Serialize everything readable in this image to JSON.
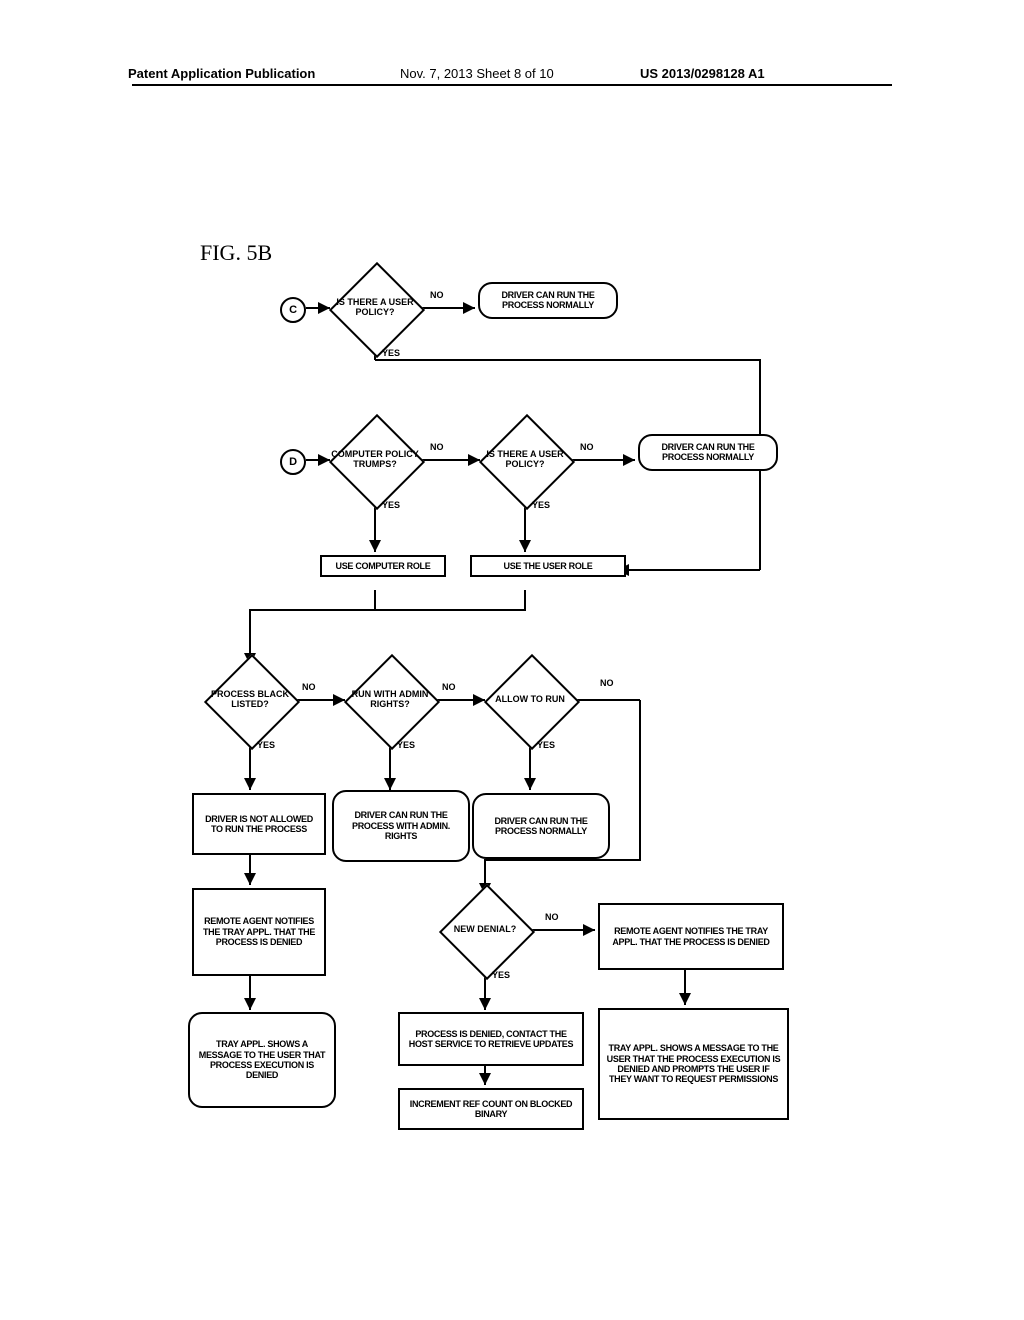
{
  "header": {
    "left": "Patent Application Publication",
    "mid": "Nov. 7, 2013  Sheet 8 of 10",
    "right": "US 2013/0298128 A1"
  },
  "fig_title": "FIG. 5B",
  "connectors": {
    "c": "C",
    "d": "D"
  },
  "decisions": {
    "d1": "IS THERE A USER POLICY?",
    "d2": "COMPUTER POLICY TRUMPS?",
    "d3": "IS THERE A USER POLICY?",
    "d4": "PROCESS BLACK LISTED?",
    "d5": "RUN WITH ADMIN RIGHTS?",
    "d6": "ALLOW TO RUN",
    "d7": "NEW DENIAL?"
  },
  "terminals": {
    "t1": "DRIVER CAN RUN THE PROCESS NORMALLY",
    "t2": "DRIVER CAN RUN THE PROCESS NORMALLY",
    "t3": "DRIVER CAN RUN THE PROCESS WITH ADMIN. RIGHTS",
    "t4": "DRIVER CAN RUN THE PROCESS NORMALLY",
    "t5": "TRAY APPL. SHOWS A MESSAGE TO THE USER THAT PROCESS EXECUTION IS DENIED"
  },
  "processes": {
    "p1": "USE COMPUTER ROLE",
    "p2": "USE THE USER ROLE",
    "p3": "DRIVER IS NOT ALLOWED TO RUN THE PROCESS",
    "p4": "REMOTE AGENT NOTIFIES THE TRAY APPL. THAT THE PROCESS IS DENIED",
    "p5": "REMOTE AGENT NOTIFIES THE TRAY APPL. THAT THE PROCESS IS DENIED",
    "p6": "PROCESS IS DENIED, CONTACT THE HOST SERVICE TO RETRIEVE UPDATES",
    "p7": "INCREMENT REF COUNT ON BLOCKED BINARY",
    "p8": "TRAY APPL. SHOWS A MESSAGE TO THE USER THAT THE PROCESS EXECUTION IS DENIED AND PROMPTS THE USER IF THEY WANT TO REQUEST PERMISSIONS"
  },
  "labels": {
    "yes": "YES",
    "no": "NO"
  }
}
